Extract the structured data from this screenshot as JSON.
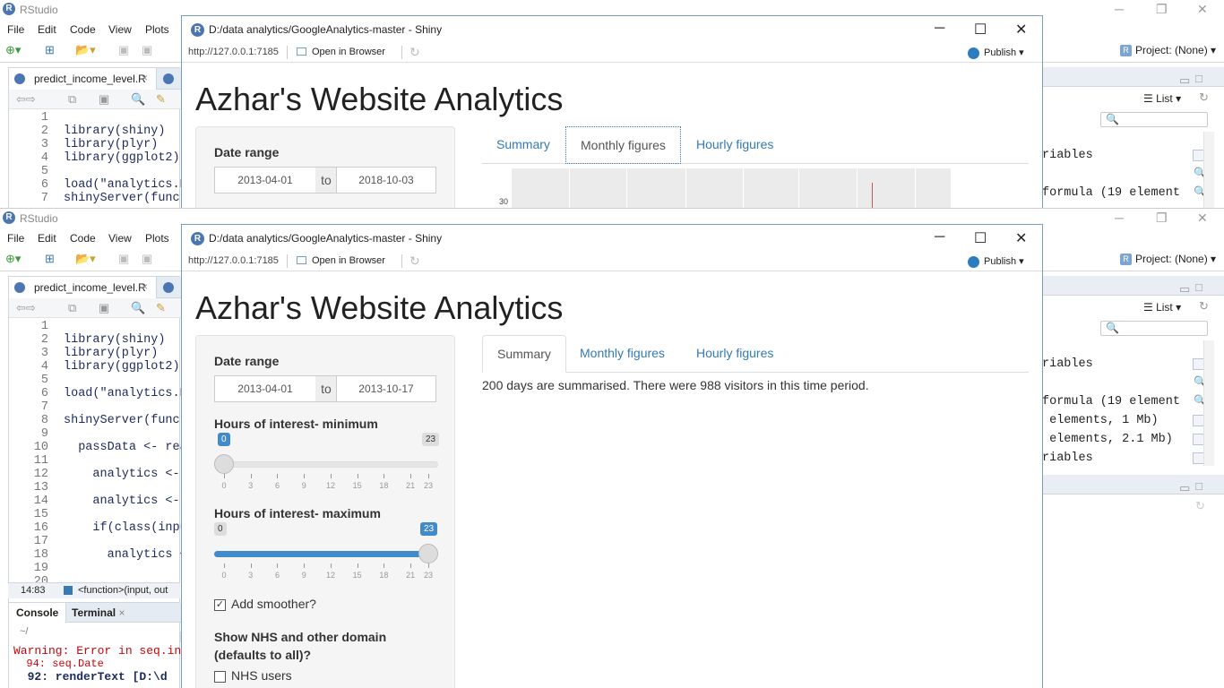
{
  "rstudio": {
    "title": "RStudio",
    "menu": [
      "File",
      "Edit",
      "Code",
      "View",
      "Plots"
    ],
    "project": "Project: (None)",
    "editor_tab": "predict_income_level.R",
    "line_numbers_top": [
      "1",
      "2",
      "3",
      "4",
      "5",
      "6",
      "7"
    ],
    "code_top": [
      "",
      "library(shiny)",
      "library(plyr)",
      "library(ggplot2)",
      "",
      "load(\"analytics.R",
      "shinyServer(funct"
    ],
    "line_numbers_bottom": [
      "1",
      "2",
      "3",
      "4",
      "5",
      "6",
      "7",
      "8",
      "9",
      "10",
      "11",
      "12",
      "13",
      "14",
      "15",
      "16",
      "17",
      "18",
      "19",
      "20"
    ],
    "code_bottom": [
      "",
      "library(shiny)",
      "library(plyr)",
      "library(ggplot2)",
      "",
      "load(\"analytics.R",
      "",
      "shinyServer(funct",
      "",
      "  passData <- rea",
      "",
      "    analytics <-",
      "",
      "    analytics <-",
      "",
      "    if(class(inpu",
      "",
      "      analytics <",
      "",
      ""
    ],
    "status_position": "14:83",
    "status_scope": "<function>(input, out",
    "console_tab": "Console",
    "terminal_tab": "Terminal",
    "console_path": "~/",
    "console_lines": [
      "Warning: Error in seq.in",
      "  94: seq.Date",
      "  92: renderText [D:\\d"
    ],
    "env_list": "List",
    "env_rows_top": [
      "riables",
      "",
      "formula (19 element"
    ],
    "env_rows_bottom": [
      "riables",
      "",
      "formula (19 element",
      " elements, 1 Mb)",
      " elements, 2.1 Mb)",
      "riables"
    ]
  },
  "shiny_top": {
    "title": "D:/data analytics/GoogleAnalytics-master - Shiny",
    "url": "http://127.0.0.1:7185",
    "open_browser": "Open in Browser",
    "publish": "Publish",
    "app_title": "Azhar's Website Analytics",
    "date_label": "Date range",
    "date_start": "2013-04-01",
    "date_to": "to",
    "date_end": "2018-10-03",
    "tabs": [
      "Summary",
      "Monthly figures",
      "Hourly figures"
    ],
    "active_tab": "Monthly figures",
    "plot_ytick": "30"
  },
  "shiny_bottom": {
    "title": "D:/data analytics/GoogleAnalytics-master - Shiny",
    "url": "http://127.0.0.1:7185",
    "open_browser": "Open in Browser",
    "publish": "Publish",
    "app_title": "Azhar's Website Analytics",
    "date_label": "Date range",
    "date_start": "2013-04-01",
    "date_to": "to",
    "date_end": "2013-10-17",
    "min_label": "Hours of interest- minimum",
    "min_value": "0",
    "min_max": "23",
    "max_label": "Hours of interest- maximum",
    "max_value": "23",
    "max_min": "0",
    "slider_ticks": [
      "0",
      "3",
      "6",
      "9",
      "12",
      "15",
      "18",
      "21",
      "23"
    ],
    "smoother_label": "Add smoother?",
    "domain_label_1": "Show NHS and other domain",
    "domain_label_2": "(defaults to all)?",
    "nhs_label": "NHS users",
    "tabs": [
      "Summary",
      "Monthly figures",
      "Hourly figures"
    ],
    "active_tab": "Summary",
    "summary_text": "200 days are summarised. There were 988 visitors in this time period."
  },
  "colors": {
    "accent": "#337ab7",
    "slider": "#428bca",
    "rstudio_blue": "#4b76b3"
  }
}
